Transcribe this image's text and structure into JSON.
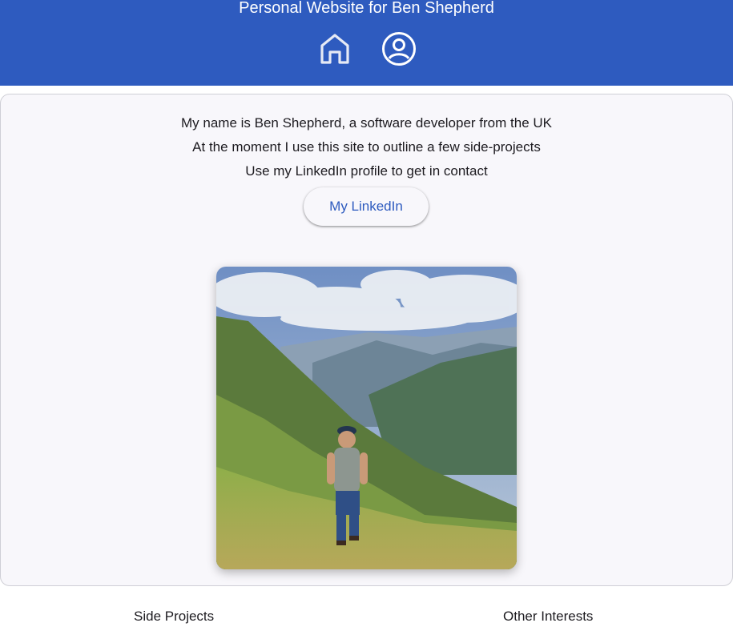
{
  "header": {
    "title": "Personal Website for Ben Shepherd",
    "nav": [
      {
        "icon": "home-icon"
      },
      {
        "icon": "account-circle-icon"
      }
    ]
  },
  "intro": {
    "lines": [
      "My name is Ben Shepherd, a software developer from the UK",
      "At the moment I use this site to outline a few side-projects",
      "Use my LinkedIn profile to get in contact"
    ],
    "linkedin_label": "My LinkedIn"
  },
  "footer": {
    "side_projects": "Side Projects",
    "other_interests": "Other Interests"
  },
  "colors": {
    "brand": "#2e5bbf",
    "card_bg": "#f8f7fb"
  }
}
